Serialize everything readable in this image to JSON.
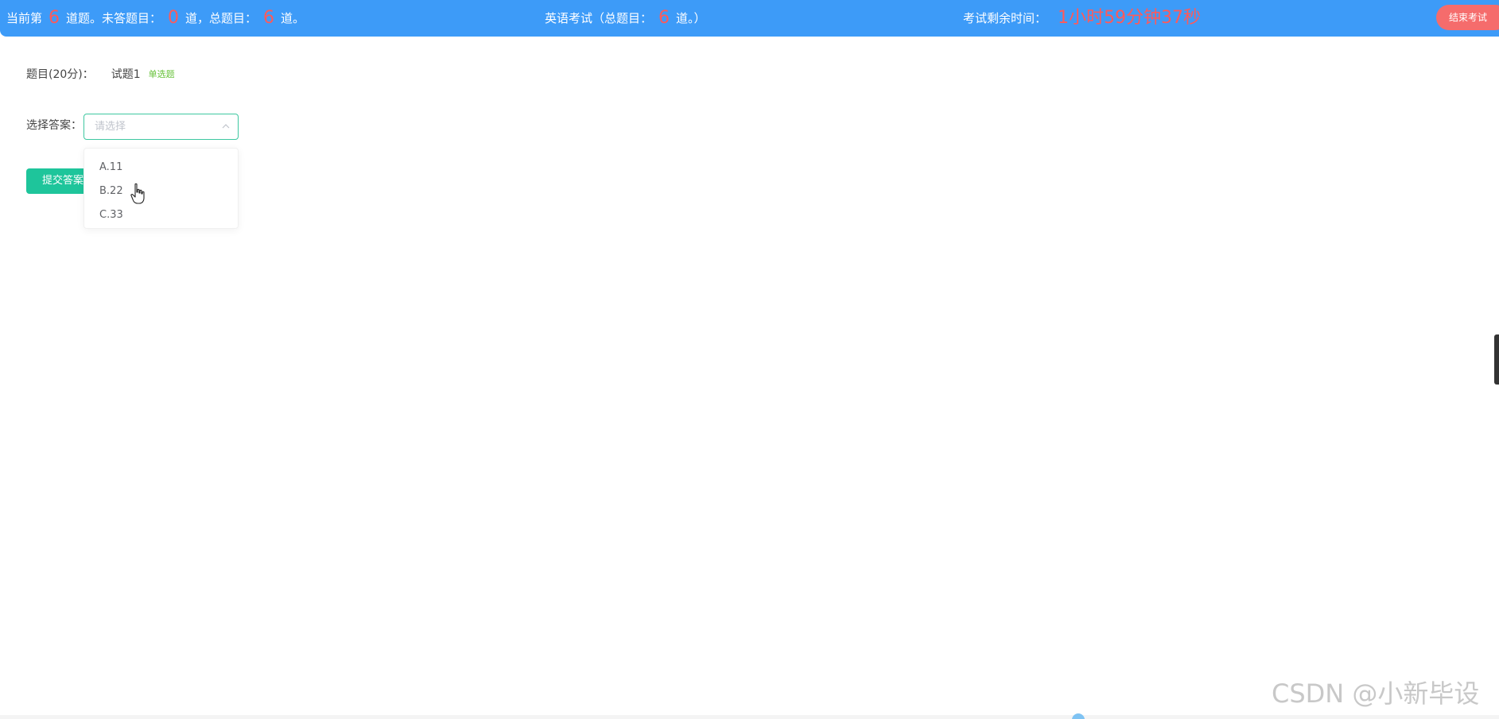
{
  "colors": {
    "topbar_bg": "#3d9bf8",
    "highlight_number": "#ff5a5a",
    "end_button": "#f56c6c",
    "submit_button": "#1ec59b",
    "tag_green": "#67c23a",
    "select_border": "#3ec7a0"
  },
  "header": {
    "progress_prefix": "当前第",
    "current_question": "6",
    "progress_mid": "道题。未答题目：",
    "unanswered": "0",
    "progress_mid2": "道，总题目：",
    "total": "6",
    "progress_suffix": "道。",
    "exam_name": "英语考试（总题目：",
    "exam_total": "6",
    "exam_suffix": "道。）",
    "time_label": "考试剩余时间：",
    "time_remaining": "1小时59分钟37秒",
    "end_button_label": "结束考试"
  },
  "question": {
    "label": "题目(20分)：",
    "title": "试题1",
    "type_tag": "单选题",
    "answer_label": "选择答案：",
    "select_placeholder": "请选择",
    "options": [
      "A.11",
      "B.22",
      "C.33"
    ],
    "submit_label": "提交答案"
  },
  "icons": {
    "dropdown_arrow": "chevron-up-icon",
    "cursor": "cursor-hand-icon"
  },
  "watermark": "CSDN @小新毕设"
}
